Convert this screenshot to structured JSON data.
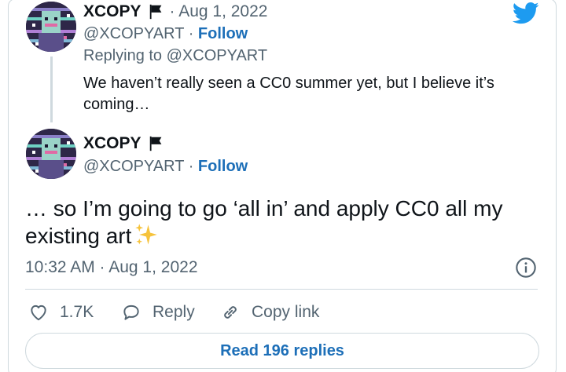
{
  "colors": {
    "twitter_blue": "#1d9bf0",
    "link_blue": "#1d6fb8",
    "secondary_text": "#536471",
    "primary_text": "#0f1419",
    "border": "#cfd9de",
    "sparkle_yellow": "#f6c33c"
  },
  "icons": {
    "brand": "twitter-bird-icon",
    "flag": "black-flag-icon",
    "emoji": "sparkles-icon",
    "info": "info-icon",
    "like": "heart-icon",
    "reply": "speech-bubble-icon",
    "copy": "link-icon"
  },
  "parent_tweet": {
    "author_name": "XCOPY",
    "date": "· Aug 1, 2022",
    "handle": "@XCOPYART",
    "separator": "·",
    "follow_label": "Follow",
    "replying_to": "Replying to @XCOPYART",
    "text": "We haven’t really seen a CC0 summer yet, but I believe it’s coming…"
  },
  "main_tweet": {
    "author_name": "XCOPY",
    "handle": "@XCOPYART",
    "separator": "·",
    "follow_label": "Follow",
    "text": "… so I’m going to go ‘all in’ and apply CC0 all my existing art",
    "timestamp": "10:32 AM · Aug 1, 2022"
  },
  "actions": {
    "likes": "1.7K",
    "reply_label": "Reply",
    "copy_link_label": "Copy link"
  },
  "read_replies_label": "Read 196 replies"
}
